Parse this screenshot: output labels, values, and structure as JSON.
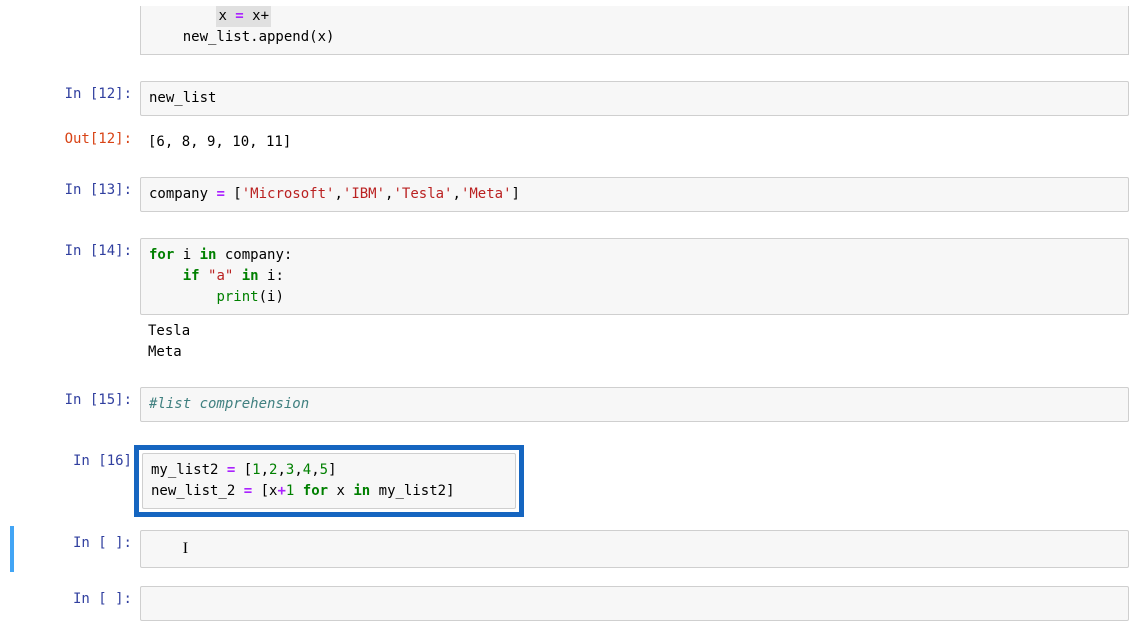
{
  "partial_top": {
    "line1_pre": "x ",
    "line1_op": "=",
    "line1_rest": " x+",
    "line2": "    new_list.append(x)"
  },
  "cells": {
    "c12": {
      "in_prompt": "In [12]:",
      "code": "new_list",
      "out_prompt": "Out[12]:",
      "output": "[6, 8, 9, 10, 11]"
    },
    "c13": {
      "in_prompt": "In [13]:",
      "code_prefix": "company ",
      "code_op": "=",
      "code_bracket_open": " [",
      "s1": "'Microsoft'",
      "s2": "'IBM'",
      "s3": "'Tesla'",
      "s4": "'Meta'",
      "code_bracket_close": "]"
    },
    "c14": {
      "in_prompt": "In [14]:",
      "kw_for": "for",
      "line1_mid": " i ",
      "kw_in": "in",
      "line1_end": " company:",
      "line2_indent": "    ",
      "kw_if": "if",
      "line2_mid": " ",
      "str_a": "\"a\"",
      "line2_mid2": " ",
      "kw_in2": "in",
      "line2_end": " i:",
      "line3_indent": "        ",
      "builtin_print": "print",
      "line3_end": "(i)",
      "output": "Tesla\nMeta"
    },
    "c15": {
      "in_prompt": "In [15]:",
      "comment": "#list comprehension"
    },
    "c16": {
      "in_prompt": "In [16]",
      "l1_a": "my_list2 ",
      "l1_op": "=",
      "l1_b": " [",
      "n1": "1",
      "n2": "2",
      "n3": "3",
      "n4": "4",
      "n5": "5",
      "l1_c": "]",
      "l2_a": "new_list_2 ",
      "l2_op": "=",
      "l2_b": " [x",
      "l2_plus": "+",
      "num1": "1",
      "l2_c": " ",
      "kw_for": "for",
      "l2_d": " x ",
      "kw_in": "in",
      "l2_e": " my_list2]"
    },
    "empty1": {
      "in_prompt": "In [ ]:"
    },
    "empty2": {
      "in_prompt": "In [ ]:"
    }
  }
}
